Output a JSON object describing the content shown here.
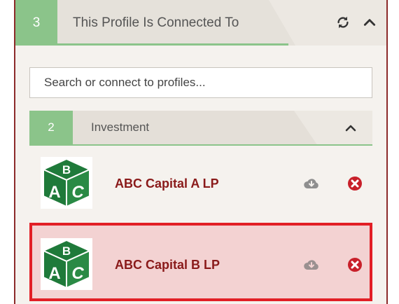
{
  "header": {
    "count": "3",
    "title": "This Profile Is Connected To",
    "refresh_icon": "refresh-icon",
    "collapse_icon": "chevron-up-icon"
  },
  "search": {
    "placeholder": "Search or connect to profiles..."
  },
  "group": {
    "count": "2",
    "label": "Investment",
    "collapse_icon": "chevron-up-icon"
  },
  "items": [
    {
      "name": "ABC Capital A LP",
      "logo_icon": "abc-blocks-logo",
      "download_icon": "cloud-download-icon",
      "remove_icon": "remove-circle-icon",
      "selected": false
    },
    {
      "name": "ABC Capital B LP",
      "logo_icon": "abc-blocks-logo",
      "download_icon": "cloud-download-icon",
      "remove_icon": "remove-circle-icon",
      "selected": true
    }
  ],
  "colors": {
    "accent_green": "#8bc48a",
    "link_red": "#8a1a1a",
    "selected_border": "#e21f26",
    "selected_bg": "#f3d2d2",
    "remove_red": "#c8202a"
  }
}
